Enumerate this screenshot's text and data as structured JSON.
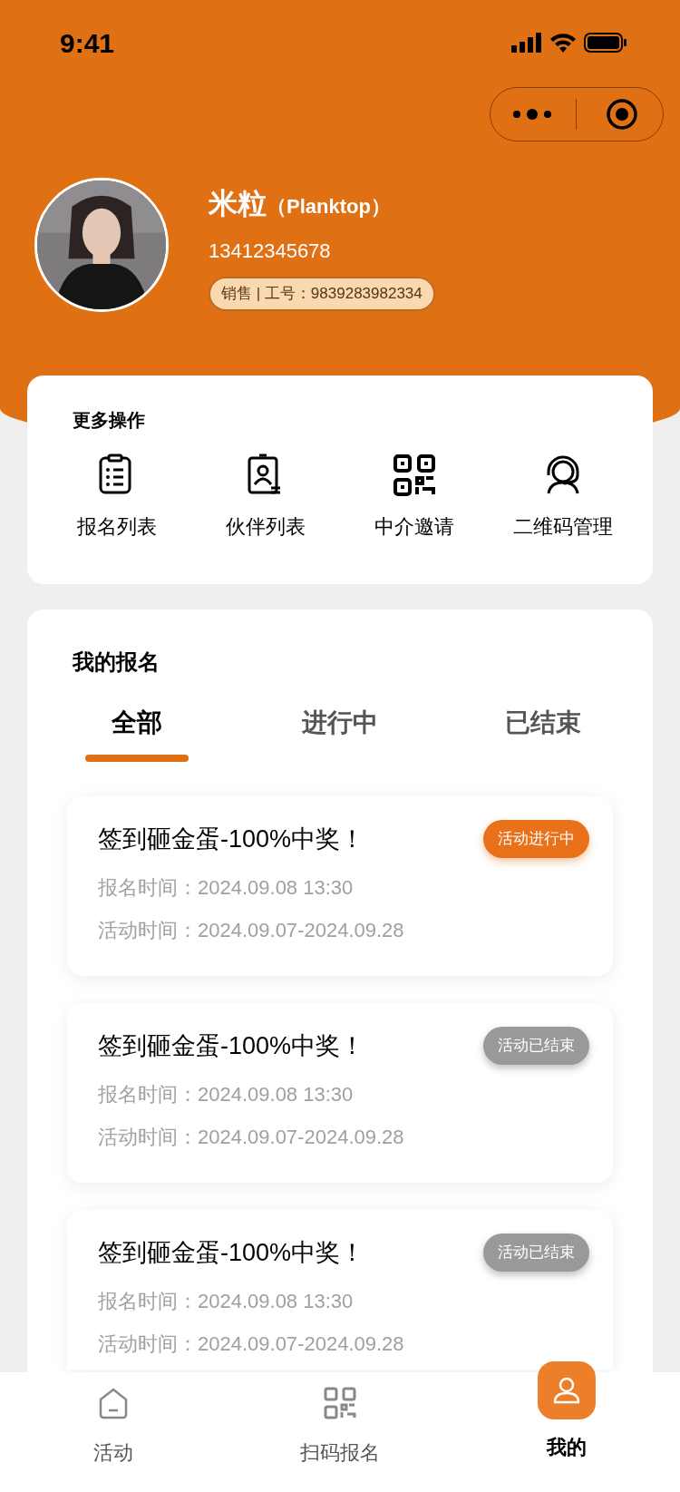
{
  "status_bar": {
    "time": "9:41"
  },
  "profile": {
    "name": "米粒",
    "nickname": "（Planktop）",
    "phone": "13412345678",
    "badge": "销售 | 工号：9839283982334"
  },
  "more_actions": {
    "title": "更多操作",
    "items": [
      {
        "label": "报名列表"
      },
      {
        "label": "伙伴列表"
      },
      {
        "label": "中介邀请"
      },
      {
        "label": "二维码管理"
      }
    ]
  },
  "my_signups": {
    "title": "我的报名",
    "tabs": [
      {
        "label": "全部",
        "selected": true
      },
      {
        "label": "进行中",
        "selected": false
      },
      {
        "label": "已结束",
        "selected": false
      }
    ],
    "items": [
      {
        "title": "签到砸金蛋-100%中奖！",
        "status": "活动进行中",
        "kind": "ongoing",
        "signup_time": "报名时间：2024.09.08 13:30",
        "activity_time": "活动时间：2024.09.07-2024.09.28"
      },
      {
        "title": "签到砸金蛋-100%中奖！",
        "status": "活动已结束",
        "kind": "ended",
        "signup_time": "报名时间：2024.09.08 13:30",
        "activity_time": "活动时间：2024.09.07-2024.09.28"
      },
      {
        "title": "签到砸金蛋-100%中奖！",
        "status": "活动已结束",
        "kind": "ended",
        "signup_time": "报名时间：2024.09.08 13:30",
        "activity_time": "活动时间：2024.09.07-2024.09.28"
      }
    ]
  },
  "tab_bar": [
    {
      "label": "活动",
      "selected": false
    },
    {
      "label": "扫码报名",
      "selected": false
    },
    {
      "label": "我的",
      "selected": true
    }
  ]
}
